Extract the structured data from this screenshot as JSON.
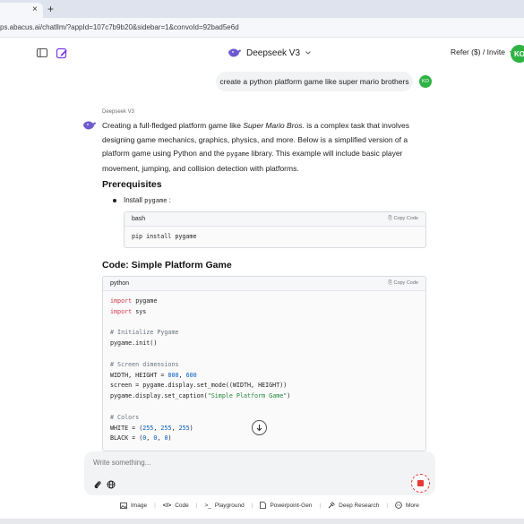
{
  "browser": {
    "tab_close": "×",
    "new_tab": "+",
    "url": "ps.abacus.ai/chatllm/?appId=107c7b9b20&sidebar=1&convoId=92bad5e6d"
  },
  "header": {
    "model_name": "Deepseek V3",
    "refer_label": "Refer ($) / Invite",
    "avatar_initials": "KO"
  },
  "conversation": {
    "user_message": "create a python platform game like super mario brothers",
    "user_initials": "KO",
    "bot_name": "Deepseek V3",
    "intro": {
      "p1": "Creating a full-fledged platform game like ",
      "italic": "Super Mario Bros.",
      "p2": " is a complex task that involves designing game mechanics, graphics, physics, and more. Below is a simplified version of a platform game using Python and the ",
      "code": "pygame",
      "p3": " library. This example will include basic player movement, jumping, and collision detection with platforms."
    },
    "prereq_heading": "Prerequisites",
    "prereq_item_prefix": "Install ",
    "prereq_item_code": "pygame",
    "prereq_item_suffix": " :",
    "install_block": {
      "language": "bash",
      "copy_label": "Copy Code",
      "code": "pip install pygame"
    },
    "code_heading": "Code: Simple Platform Game",
    "code_block": {
      "language": "python",
      "copy_label": "Copy Code",
      "lines": [
        {
          "t": "import pygame",
          "k": "kwimport"
        },
        {
          "t": "import sys",
          "k": "kwimport"
        },
        {
          "t": "",
          "k": "plain"
        },
        {
          "t": "# Initialize Pygame",
          "k": "comment"
        },
        {
          "t": "pygame.init()",
          "k": "plain"
        },
        {
          "t": "",
          "k": "plain"
        },
        {
          "t": "# Screen dimensions",
          "k": "comment"
        },
        {
          "t": "WIDTH, HEIGHT = 800, 600",
          "k": "nums"
        },
        {
          "t": "screen = pygame.display.set_mode((WIDTH, HEIGHT))",
          "k": "plain"
        },
        {
          "t": "pygame.display.set_caption(\"Simple Platform Game\")",
          "k": "string"
        },
        {
          "t": "",
          "k": "plain"
        },
        {
          "t": "# Colors",
          "k": "comment"
        },
        {
          "t": "WHITE = (255, 255, 255)",
          "k": "nums"
        },
        {
          "t": "BLACK = (0, 0, 0)",
          "k": "nums"
        }
      ]
    }
  },
  "composer": {
    "placeholder": "Write something..."
  },
  "toolbar": {
    "items": [
      "Image",
      "Code",
      "Playground",
      "Powerpoint-Gen",
      "Deep Research",
      "More"
    ],
    "separator": "|"
  },
  "colors": {
    "accent_green": "#2fb344",
    "stop_red": "#e53935",
    "purple_icon": "#7c3aed"
  }
}
